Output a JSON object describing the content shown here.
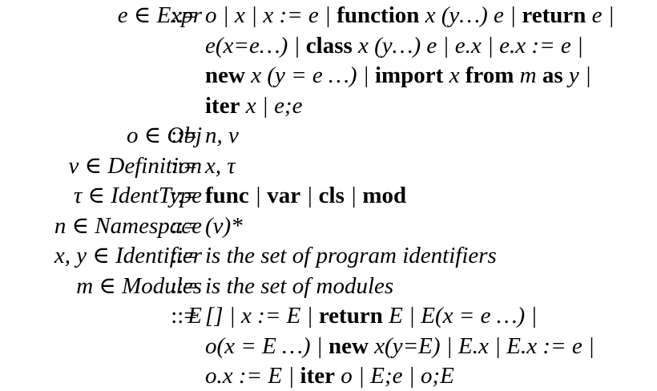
{
  "rules": [
    {
      "lhs": "e ∈ Expr",
      "op": "::=",
      "lines": [
        "o | x | x := e | **function** x (y…) e | **return** e |",
        "e(x=e…) | **class** x (y…) e | e.x | e.x := e |",
        "**new** x (y = e …) | **import** x **from** m **as** y |",
        "**iter** x | e;e"
      ]
    },
    {
      "lhs": "o ∈ Obj",
      "op": "::=",
      "lines": [
        "n, v"
      ]
    },
    {
      "lhs": "v ∈ Definition",
      "op": "::=",
      "lines": [
        "x, τ"
      ]
    },
    {
      "lhs": "τ ∈ IdentType",
      "op": "::=",
      "lines": [
        "**func** | **var** | **cls** | **mod**"
      ]
    },
    {
      "lhs": "n ∈ Namespace",
      "op": "::=",
      "lines": [
        "(v)*"
      ]
    },
    {
      "lhs": "x, y ∈ Identifier",
      "op": "::=",
      "lines": [
        "is the set of program identifiers"
      ]
    },
    {
      "lhs": "m ∈ Modules",
      "op": "::=",
      "lines": [
        "is the set of modules"
      ]
    },
    {
      "lhs": "E",
      "op": "::=",
      "lines": [
        "[] | x := E | **return** E | E(x = e …) |",
        "o(x = E …) | **new** x(y=E) | E.x | E.x := e |",
        "o.x := E | **iter** o | E;e | o;E"
      ]
    }
  ]
}
